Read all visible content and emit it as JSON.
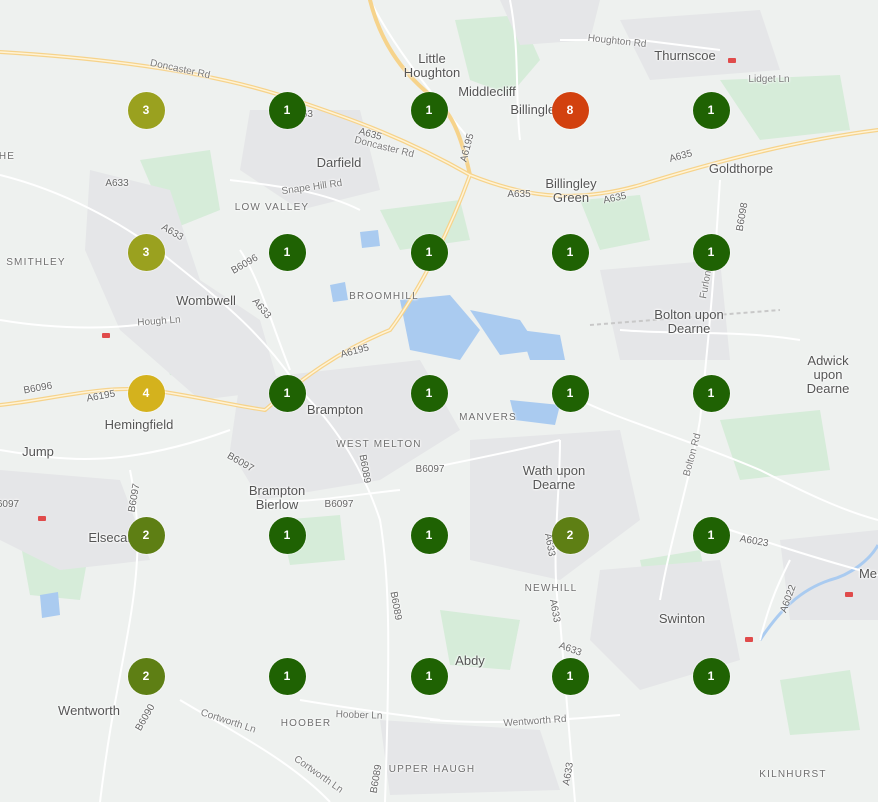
{
  "colors": {
    "green": "#1f6203",
    "olive_green": "#5e7f14",
    "olive": "#9aa11f",
    "yellow": "#d4b21d",
    "red": "#d2410f"
  },
  "places": [
    {
      "id": "little-houghton",
      "text": "Little\nHoughton",
      "kind": "town"
    },
    {
      "id": "middlecliff",
      "text": "Middlecliff",
      "kind": "town"
    },
    {
      "id": "thurnscoe",
      "text": "Thurnscoe",
      "kind": "town"
    },
    {
      "id": "billingley",
      "text": "Billingley",
      "kind": "town"
    },
    {
      "id": "darfield",
      "text": "Darfield",
      "kind": "town"
    },
    {
      "id": "goldthorpe",
      "text": "Goldthorpe",
      "kind": "town"
    },
    {
      "id": "billingley-green",
      "text": "Billingley\nGreen",
      "kind": "town"
    },
    {
      "id": "low-valley",
      "text": "LOW VALLEY",
      "kind": "area"
    },
    {
      "id": "smithley",
      "text": "SMITHLEY",
      "kind": "area"
    },
    {
      "id": "wombwell",
      "text": "Wombwell",
      "kind": "town"
    },
    {
      "id": "broomhill",
      "text": "BROOMHILL",
      "kind": "area"
    },
    {
      "id": "bolton-upon-dearne",
      "text": "Bolton upon\nDearne",
      "kind": "town"
    },
    {
      "id": "adwick-upon-dearne",
      "text": "Adwick\nupon Dearne",
      "kind": "town"
    },
    {
      "id": "hemingfield",
      "text": "Hemingfield",
      "kind": "town"
    },
    {
      "id": "brampton",
      "text": "Brampton",
      "kind": "town"
    },
    {
      "id": "manvers",
      "text": "MANVERS",
      "kind": "area"
    },
    {
      "id": "jump",
      "text": "Jump",
      "kind": "town"
    },
    {
      "id": "west-melton",
      "text": "WEST MELTON",
      "kind": "area"
    },
    {
      "id": "wath-upon-dearne",
      "text": "Wath upon\nDearne",
      "kind": "town"
    },
    {
      "id": "brampton-bierlow",
      "text": "Brampton\nBierlow",
      "kind": "town"
    },
    {
      "id": "elsecar",
      "text": "Elsecar",
      "kind": "town"
    },
    {
      "id": "newhill",
      "text": "NEWHILL",
      "kind": "area"
    },
    {
      "id": "swinton",
      "text": "Swinton",
      "kind": "town"
    },
    {
      "id": "abdy",
      "text": "Abdy",
      "kind": "town"
    },
    {
      "id": "wentworth",
      "text": "Wentworth",
      "kind": "town"
    },
    {
      "id": "hoober",
      "text": "HOOBER",
      "kind": "area"
    },
    {
      "id": "upper-haugh",
      "text": "UPPER HAUGH",
      "kind": "area"
    },
    {
      "id": "kilnhurst",
      "text": "KILNHURST",
      "kind": "area"
    },
    {
      "id": "mexborough",
      "text": "Me",
      "kind": "town"
    },
    {
      "id": "he",
      "text": "HE",
      "kind": "area"
    }
  ],
  "roads": [
    {
      "id": "doncaster-rd-1",
      "text": "Doncaster Rd"
    },
    {
      "id": "doncaster-rd-2",
      "text": "Doncaster Rd"
    },
    {
      "id": "houghton-rd",
      "text": "Houghton Rd"
    },
    {
      "id": "lidget-ln",
      "text": "Lidget Ln"
    },
    {
      "id": "snape-hill-rd",
      "text": "Snape Hill Rd"
    },
    {
      "id": "hough-ln",
      "text": "Hough Ln"
    },
    {
      "id": "bolton-rd",
      "text": "Bolton Rd"
    },
    {
      "id": "furlong-rd",
      "text": "Furlong"
    },
    {
      "id": "hoober-ln",
      "text": "Hoober Ln"
    },
    {
      "id": "cortworth-ln-1",
      "text": "Cortworth Ln"
    },
    {
      "id": "cortworth-ln-2",
      "text": "Cortworth Ln"
    },
    {
      "id": "wentworth-rd",
      "text": "Wentworth Rd"
    }
  ],
  "route_labels": [
    {
      "id": "a635-1",
      "text": "A635"
    },
    {
      "id": "a635-2",
      "text": "A635"
    },
    {
      "id": "a635-3",
      "text": "A635"
    },
    {
      "id": "a635-4",
      "text": "A635"
    },
    {
      "id": "a6195-1",
      "text": "A6195"
    },
    {
      "id": "a6195-2",
      "text": "A6195"
    },
    {
      "id": "a6195-3",
      "text": "A6195"
    },
    {
      "id": "a6195-4",
      "text": "A6195"
    },
    {
      "id": "a633-1",
      "text": "A633"
    },
    {
      "id": "a633-2",
      "text": "A633"
    },
    {
      "id": "a633-3",
      "text": "A633"
    },
    {
      "id": "a633-4",
      "text": "A633"
    },
    {
      "id": "a633-5",
      "text": "A633"
    },
    {
      "id": "a633-6",
      "text": "A633"
    },
    {
      "id": "a633-7",
      "text": "A633"
    },
    {
      "id": "b6096-1",
      "text": "B6096"
    },
    {
      "id": "b6096-2",
      "text": "B6096"
    },
    {
      "id": "b6097-1",
      "text": "B6097"
    },
    {
      "id": "b6097-2",
      "text": "B6097"
    },
    {
      "id": "b6097-3",
      "text": "B6097"
    },
    {
      "id": "b6097-4",
      "text": "B6097"
    },
    {
      "id": "b6097-5",
      "text": "6097"
    },
    {
      "id": "b6089-1",
      "text": "B6089"
    },
    {
      "id": "b6089-2",
      "text": "B6089"
    },
    {
      "id": "b6089-3",
      "text": "B6089"
    },
    {
      "id": "b6098",
      "text": "B6098"
    },
    {
      "id": "a6023",
      "text": "A6023"
    },
    {
      "id": "a6022",
      "text": "A6022"
    },
    {
      "id": "b6090",
      "text": "B6090"
    },
    {
      "id": "a633-8",
      "text": "A63"
    }
  ],
  "clusters": [
    {
      "count": "3",
      "color": "olive"
    },
    {
      "count": "1",
      "color": "green"
    },
    {
      "count": "1",
      "color": "green"
    },
    {
      "count": "8",
      "color": "red"
    },
    {
      "count": "1",
      "color": "green"
    },
    {
      "count": "3",
      "color": "olive"
    },
    {
      "count": "1",
      "color": "green"
    },
    {
      "count": "1",
      "color": "green"
    },
    {
      "count": "1",
      "color": "green"
    },
    {
      "count": "1",
      "color": "green"
    },
    {
      "count": "4",
      "color": "yellow"
    },
    {
      "count": "1",
      "color": "green"
    },
    {
      "count": "1",
      "color": "green"
    },
    {
      "count": "1",
      "color": "green"
    },
    {
      "count": "1",
      "color": "green"
    },
    {
      "count": "2",
      "color": "olive_green"
    },
    {
      "count": "1",
      "color": "green"
    },
    {
      "count": "1",
      "color": "green"
    },
    {
      "count": "2",
      "color": "olive_green"
    },
    {
      "count": "1",
      "color": "green"
    },
    {
      "count": "2",
      "color": "olive_green"
    },
    {
      "count": "1",
      "color": "green"
    },
    {
      "count": "1",
      "color": "green"
    },
    {
      "count": "1",
      "color": "green"
    },
    {
      "count": "1",
      "color": "green"
    }
  ]
}
